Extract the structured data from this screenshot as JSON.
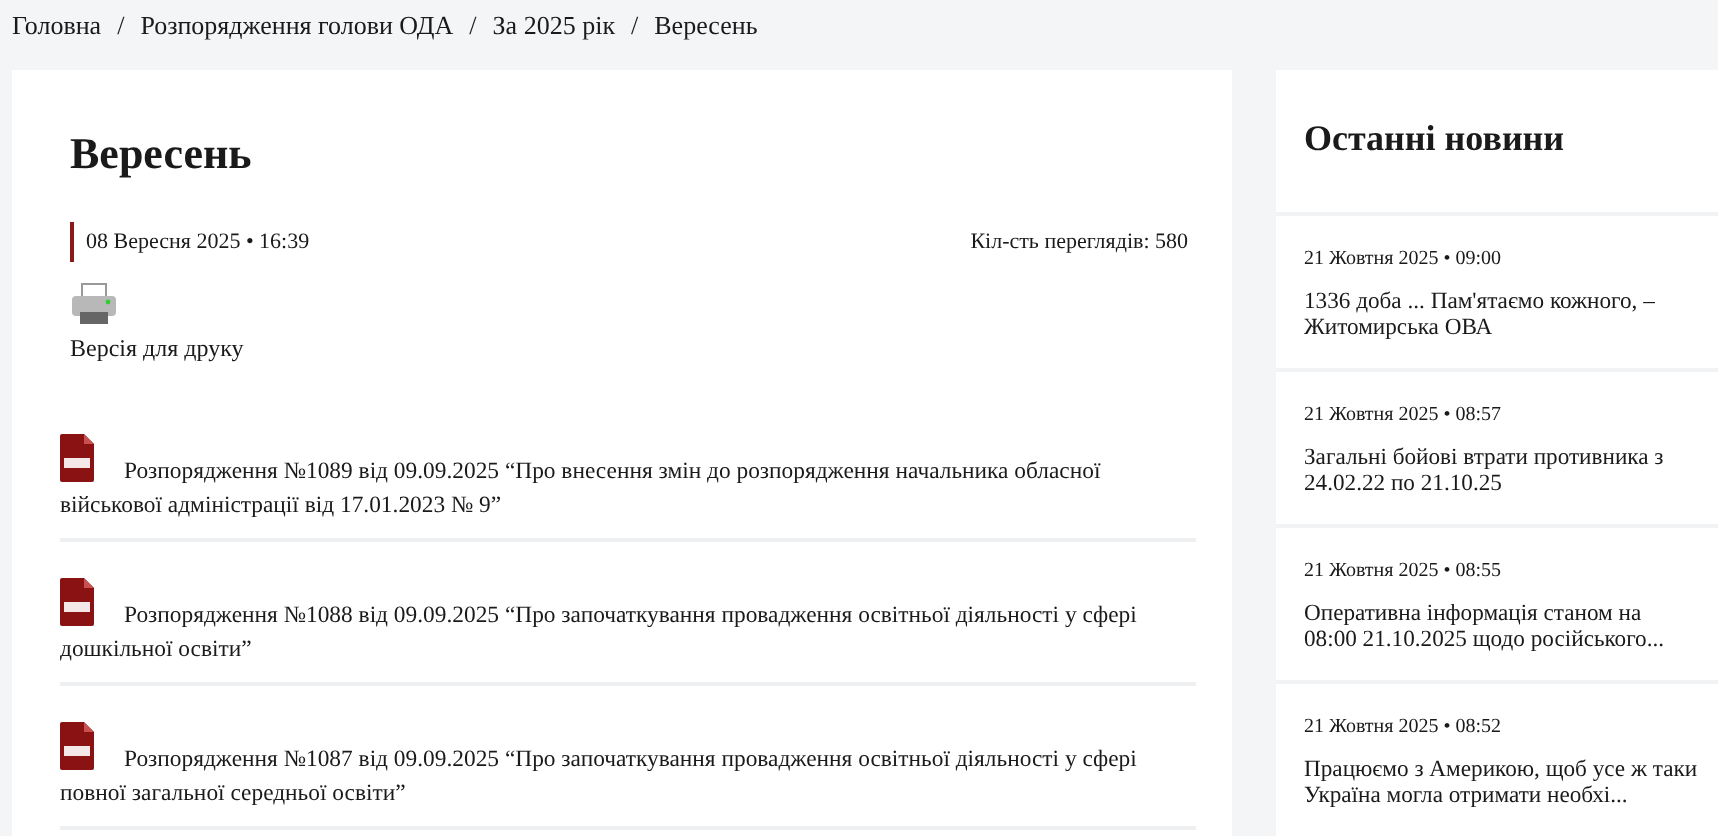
{
  "breadcrumbs": [
    {
      "label": "Головна"
    },
    {
      "separator": "/",
      "label": "Розпорядження голови ОДА"
    },
    {
      "separator": "/",
      "label": "За 2025 рік"
    },
    {
      "separator": "/",
      "label": "Вересень"
    }
  ],
  "article": {
    "title": "Вересень",
    "date": "08 Вересня 2025 • 16:39",
    "views": "Кіл-сть переглядів: 580",
    "print_label": "Версія для друку",
    "documents": [
      {
        "text": "Розпорядження №1089 від 09.09.2025 “Про внесення змін до розпорядження начальника обласної військової адміністрації від 17.01.2023 № 9”"
      },
      {
        "text": "Розпорядження №1088 від 09.09.2025 “Про започаткування провадження освітньої діяльності у сфері дошкільної освіти”"
      },
      {
        "text": "Розпорядження №1087 від 09.09.2025 “Про започаткування провадження освітньої діяльності у сфері повної загальної середньої освіти”"
      }
    ]
  },
  "sidebar": {
    "title": "Останні новини",
    "news": [
      {
        "date": "21 Жовтня 2025 • 09:00",
        "title": "1336 доба ... Пам'ятаємо кожного, – Житомирська ОВА"
      },
      {
        "date": "21 Жовтня 2025 • 08:57",
        "title": "Загальні бойові втрати противника з 24.02.22 по 21.10.25"
      },
      {
        "date": "21 Жовтня 2025 • 08:55",
        "title": "Оперативна інформація станом на 08:00 21.10.2025 щодо російського..."
      },
      {
        "date": "21 Жовтня 2025 • 08:52",
        "title": "Працюємо з Америкою, щоб усе ж таки Україна могла отримати необхі..."
      }
    ]
  }
}
